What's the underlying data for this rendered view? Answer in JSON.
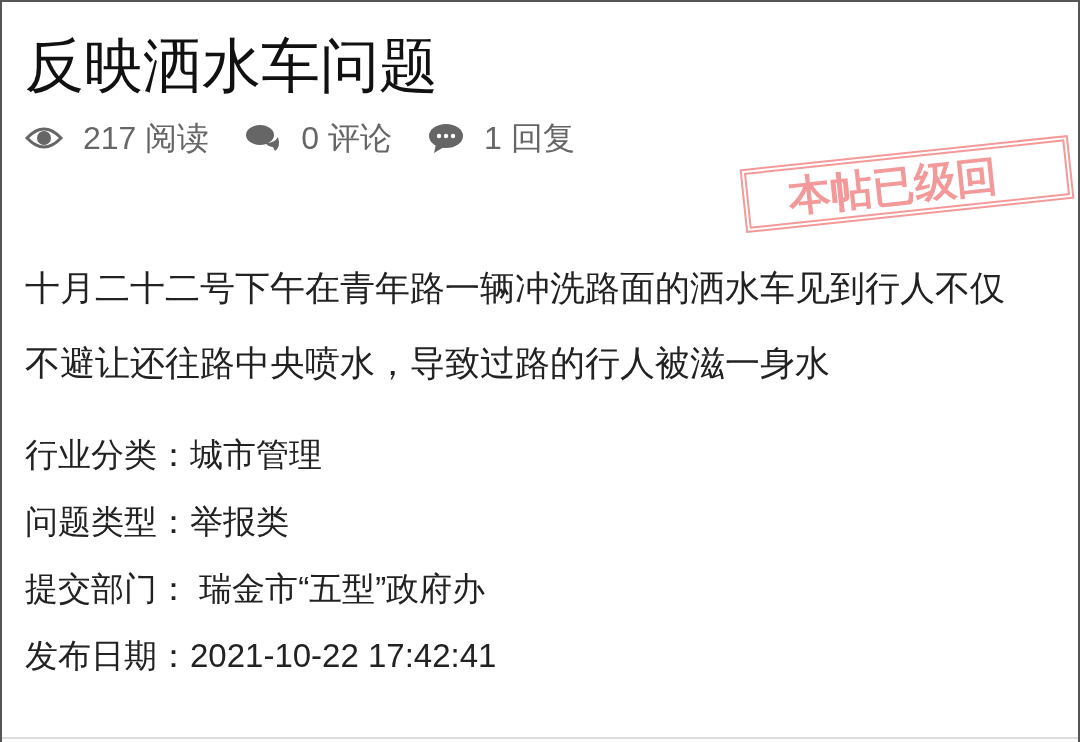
{
  "title": "反映洒水车问题",
  "stats": [
    {
      "kind": "views",
      "text": "217 阅读"
    },
    {
      "kind": "comments",
      "text": "0 评论"
    },
    {
      "kind": "replies",
      "text": "1 回复"
    }
  ],
  "stamp": "本帖已级回",
  "body": "十月二十二号下午在青年路一辆冲洗路面的洒水车见到行人不仅不避让还往路中央喷水，导致过路的行人被滋一身水",
  "fields": [
    {
      "label": "行业分类：",
      "value": "城市管理"
    },
    {
      "label": "问题类型：",
      "value": "举报类"
    },
    {
      "label": "提交部门：",
      "value": " 瑞金市“五型”政府办"
    },
    {
      "label": "发布日期：",
      "value": "2021-10-22 17:42:41"
    }
  ]
}
